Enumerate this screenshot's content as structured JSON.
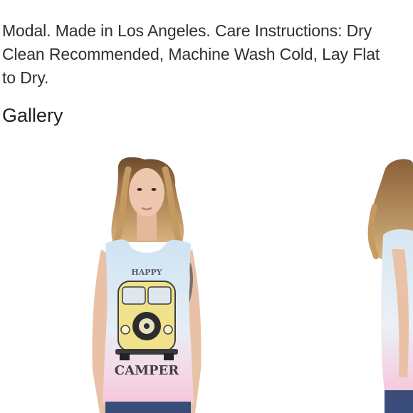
{
  "product": {
    "description_lines": [
      "Modal. Made in Los Angeles. Care Instructions: Dry",
      "Clean Recommended, Machine Wash Cold, Lay Flat",
      "to Dry."
    ]
  },
  "gallery": {
    "heading": "Gallery",
    "images": [
      {
        "alt": "Model wearing tie-dye muscle tank with Happy Camper van print, front view"
      },
      {
        "alt": "Model wearing tie-dye muscle tank, side view"
      }
    ]
  },
  "colors": {
    "text": "#2f2f2f",
    "tank_top_blue": "#cfe3f3",
    "tank_bottom_pink": "#f4c8dc",
    "van_yellow": "#efe28a",
    "hair": "#b98a55",
    "skin": "#e8c2a8",
    "jeans": "#3a4d7a"
  }
}
